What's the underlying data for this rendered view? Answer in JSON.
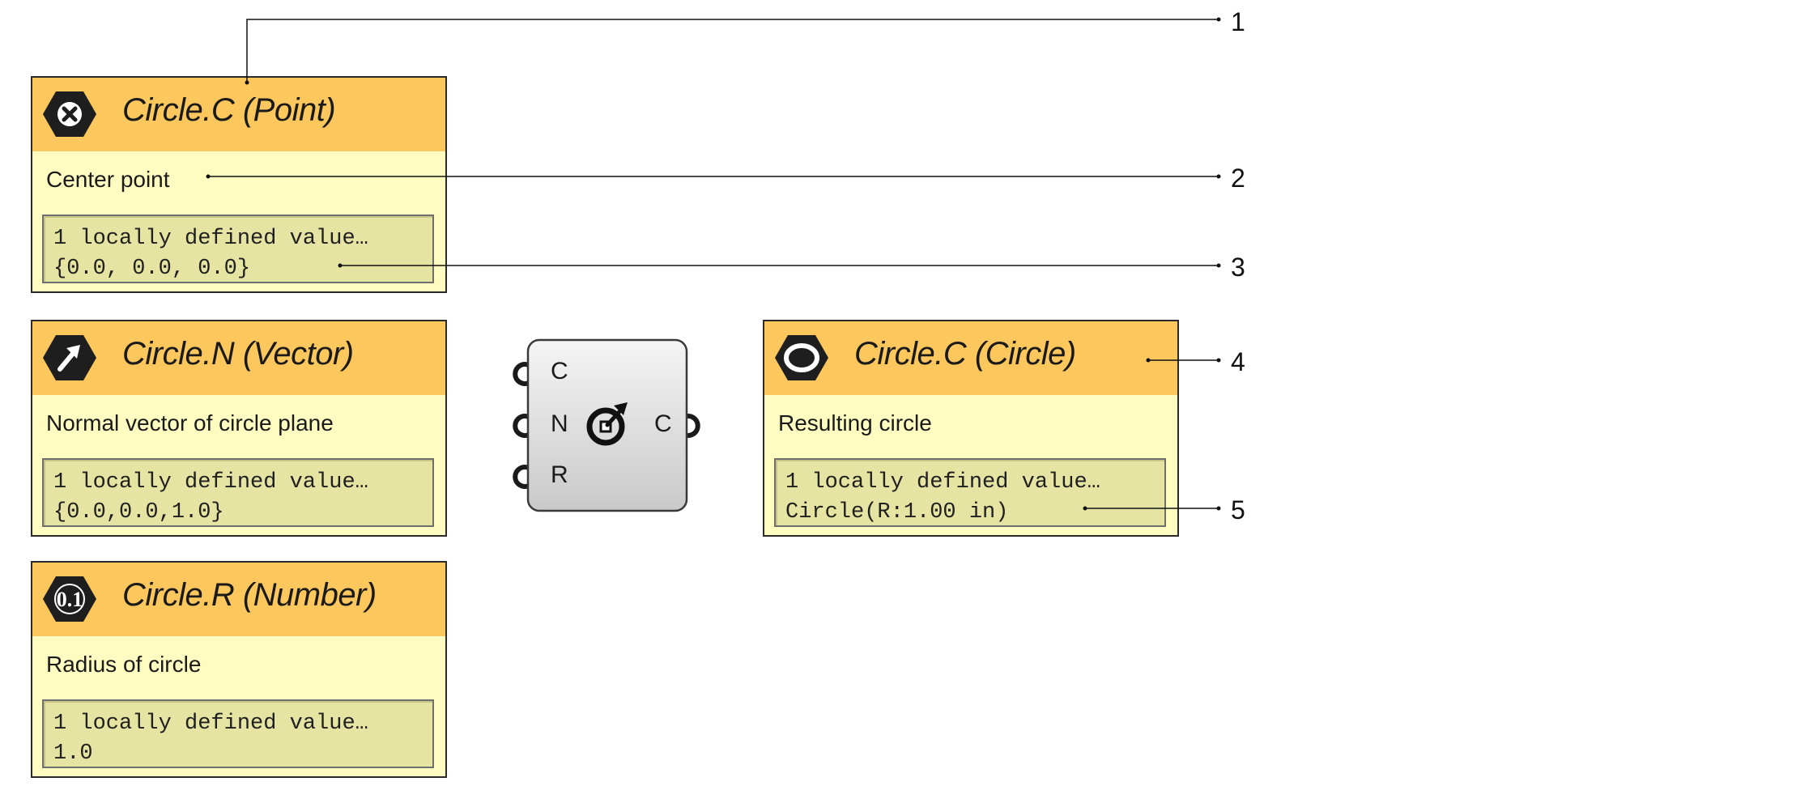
{
  "inputs": [
    {
      "title": "Circle.C (Point)",
      "description": "Center point",
      "value_line1": "1 locally defined value…",
      "value_line2": "{0.0, 0.0, 0.0}",
      "icon": "point-icon"
    },
    {
      "title": "Circle.N (Vector)",
      "description": "Normal vector of circle plane",
      "value_line1": "1 locally defined value…",
      "value_line2": "{0.0,0.0,1.0}",
      "icon": "vector-arrow-icon"
    },
    {
      "title": "Circle.R (Number)",
      "description": "Radius of circle",
      "value_line1": "1 locally defined value…",
      "value_line2": "1.0",
      "icon": "number-icon",
      "icon_text": "0.1"
    }
  ],
  "component": {
    "inputs": [
      "C",
      "N",
      "R"
    ],
    "output": "C",
    "icon": "circle-cnr-icon"
  },
  "output": {
    "title": "Circle.C (Circle)",
    "description": "Resulting circle",
    "value_line1": "1 locally defined value…",
    "value_line2": "Circle(R:1.00 in)",
    "icon": "circle-icon"
  },
  "callouts": [
    "1",
    "2",
    "3",
    "4",
    "5"
  ],
  "colors": {
    "header": "#fcc75c",
    "body": "#fffcc2",
    "value_box": "#e6e4a3",
    "icon": "#1e1e1e"
  }
}
